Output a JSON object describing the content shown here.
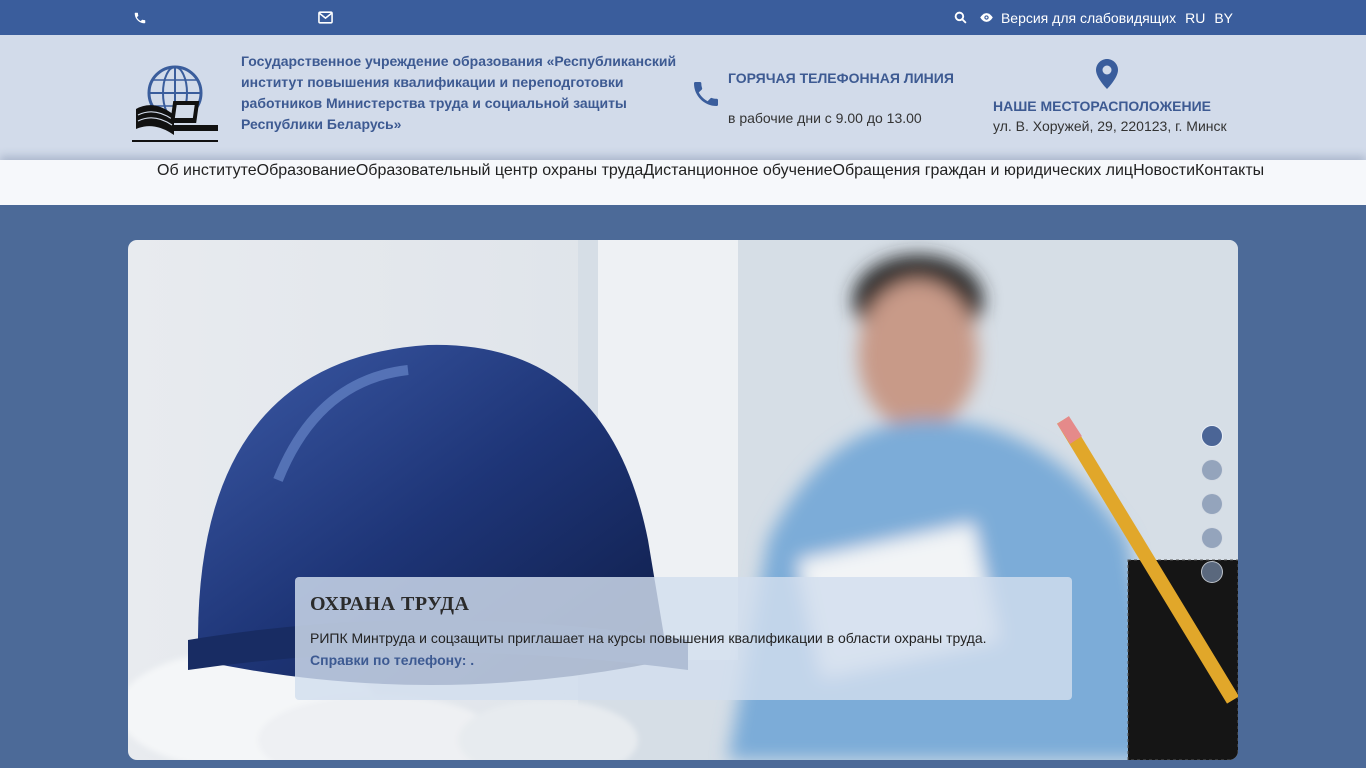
{
  "topbar": {
    "low_vision_label": "Версия для слабовидящих",
    "lang_ru": "RU",
    "lang_by": "BY"
  },
  "header": {
    "org_title": "Государственное учреждение образования «Республиканский институт повышения квалификации и переподготовки работников Министерства труда и социальной защиты Республики Беларусь»",
    "hotline_title": "ГОРЯЧАЯ ТЕЛЕФОННАЯ ЛИНИЯ",
    "hotline_hours": "в рабочие дни с 9.00 до 13.00",
    "location_title": "НАШЕ МЕСТОРАСПОЛОЖЕНИЕ",
    "location_address": "ул. В. Хоружей, 29, 220123, г. Минск"
  },
  "nav": {
    "items": [
      "Об институте",
      "Образование",
      "Образовательный центр охраны труда",
      "Дистанционное обучение",
      "Обращения граждан и юридических лиц",
      "Новости",
      "Контакты"
    ]
  },
  "slider": {
    "caption_title": "ОХРАНА ТРУДА",
    "caption_text": "РИПК Минтруда и соцзащиты приглашает на курсы повышения квалификации в области охраны труда.",
    "caption_phone": "Справки по телефону: .",
    "slide_count": 5,
    "active_slide": 1
  },
  "colors": {
    "topbar": "#3a5d9c",
    "header": "#d2dbea",
    "accent": "#3d5a92",
    "page_bg": "#4c6a98"
  },
  "icons": [
    "phone-icon",
    "mail-icon",
    "search-icon",
    "eye-icon",
    "map-pin-icon"
  ]
}
